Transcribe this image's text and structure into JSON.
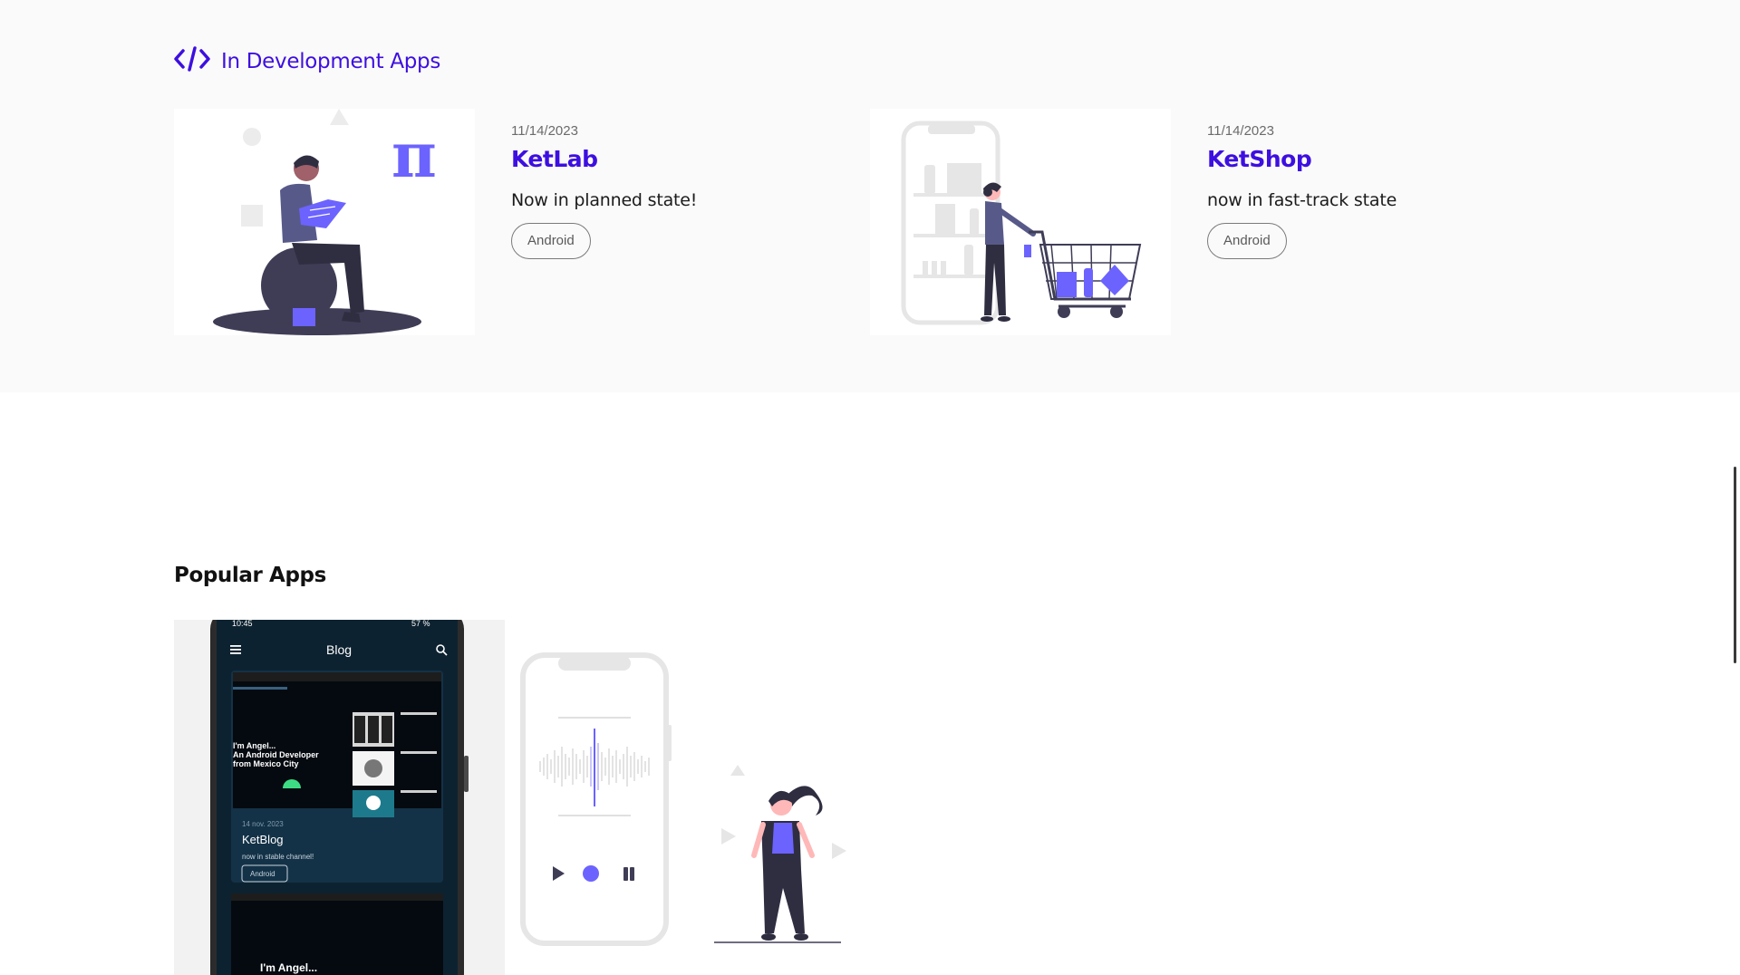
{
  "dev_section": {
    "title": "In Development Apps",
    "icon": "code-icon",
    "accent_color": "#3d0fe0",
    "apps": [
      {
        "date": "11/14/2023",
        "name": "KetLab",
        "description": "Now in planned state!",
        "tag": "Android",
        "illustration": "reading-person-pi-illustration"
      },
      {
        "date": "11/14/2023",
        "name": "KetShop",
        "description": "now in fast-track state",
        "tag": "Android",
        "illustration": "shopping-cart-illustration"
      }
    ]
  },
  "popular_section": {
    "title": "Popular Apps",
    "screenshot": {
      "status_time": "10:45",
      "status_battery": "57 %",
      "app_bar_title": "Blog",
      "hero_text": "I'm Angel...\nAn Android Developer\nfrom Mexico City",
      "card_date": "14 nov. 2023",
      "card_title": "KetBlog",
      "card_desc": "now in stable channel!",
      "card_tag": "Android",
      "next_hero_text": "I'm Angel..."
    }
  }
}
